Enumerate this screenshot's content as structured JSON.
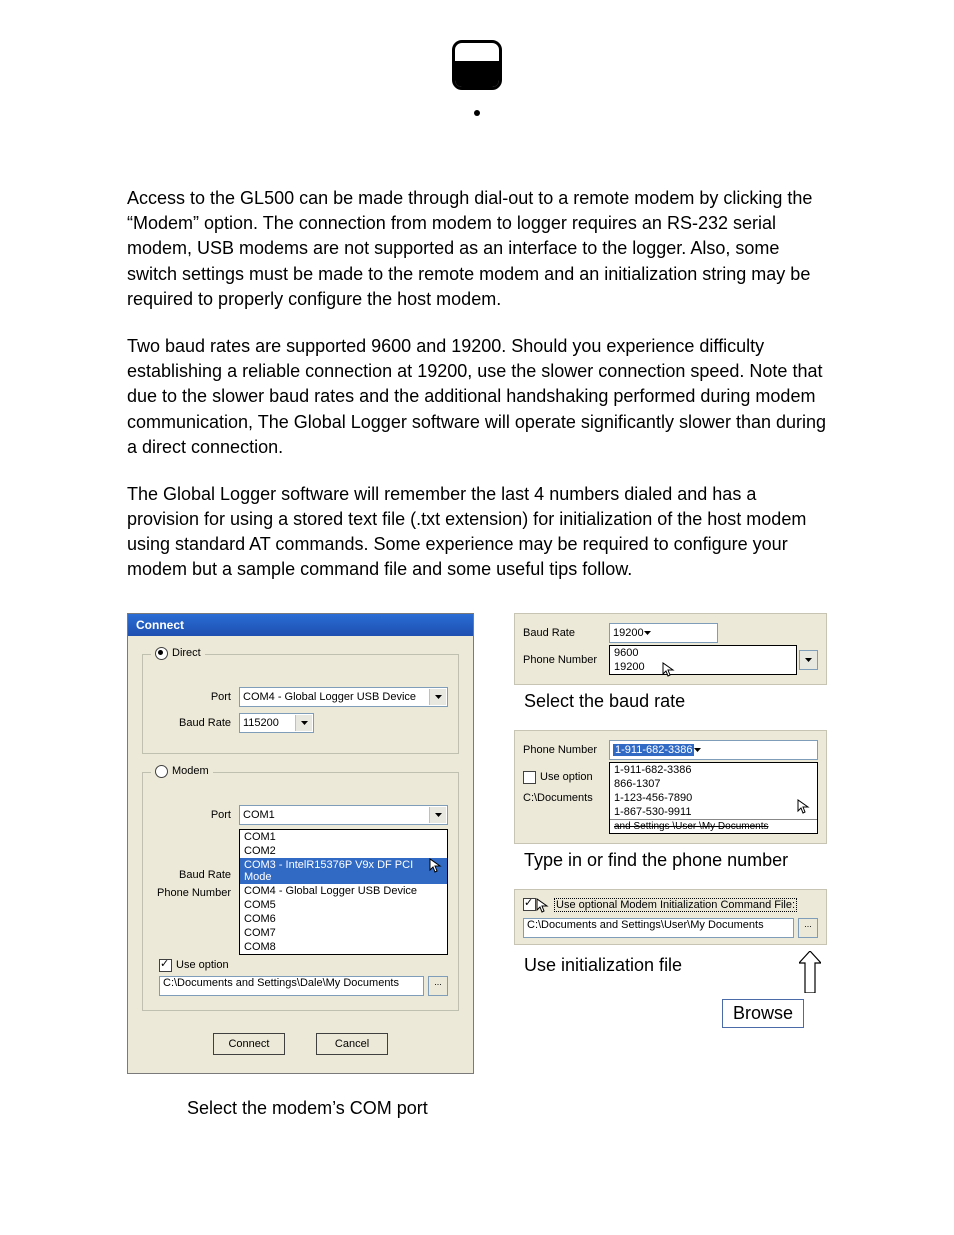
{
  "paragraphs": {
    "p1": "Access to the GL500 can be made through dial-out to a remote modem by clicking the “Modem” option.  The connection from modem to logger requires an RS-232 serial modem, USB modems are not supported as an interface to the logger.  Also, some switch settings must be made to the remote modem and an initialization string may be required to properly configure the host modem.",
    "p2": "Two baud rates are supported 9600 and 19200.  Should you experience difficulty establishing a reliable connection at 19200, use the slower connection speed.  Note that due to the slower baud rates and the additional handshaking performed during modem communication, The Global Logger software will operate significantly slower than during a direct connection.",
    "p3": "The Global Logger software will remember the last 4 numbers dialed and has a provision for using a stored text file (.txt extension) for initialization of the host modem using standard AT commands.  Some experience may be required to configure your modem but a sample command file and some useful tips follow."
  },
  "dialog": {
    "title": "Connect",
    "direct": {
      "label": "Direct",
      "port_label": "Port",
      "port_value": "COM4 - Global Logger USB Device",
      "baud_label": "Baud Rate",
      "baud_value": "115200"
    },
    "modem": {
      "label": "Modem",
      "port_label": "Port",
      "port_value": "COM1",
      "baud_label": "Baud Rate",
      "phone_label": "Phone Number",
      "use_option_label": "Use option",
      "path_value": "C:\\Documents and Settings\\Dale\\My Documents",
      "dropdown": {
        "o1": "COM1",
        "o2": "COM2",
        "o3": "COM3 - IntelR15376P V9x DF PCI Mode",
        "o4": "COM4 - Global Logger USB Device",
        "o5": "COM5",
        "o6": "COM6",
        "o7": "COM7",
        "o8": "COM8"
      }
    },
    "connect_btn": "Connect",
    "cancel_btn": "Cancel",
    "browse_btn": "...",
    "caption": "Select the modem’s COM port"
  },
  "right": {
    "baud": {
      "baud_label": "Baud Rate",
      "baud_value": "19200",
      "phone_label": "Phone Number",
      "opt1": "9600",
      "opt2": "19200",
      "caption": "Select the baud rate"
    },
    "phone": {
      "phone_label": "Phone Number",
      "phone_value": "1-911-682-3386",
      "use_option_label": "Use option",
      "path_prefix": "C:\\Documents",
      "path_suffix": " and Settings \\User \\My Documents",
      "opt1": "1-911-682-3386",
      "opt2": "866-1307",
      "opt3": "1-123-456-7890",
      "opt4": "1-867-530-9911",
      "caption": "Type in or find the phone number"
    },
    "init": {
      "check_label": "Use optional Modem Initialization Command File:",
      "path_value": "C:\\Documents and Settings\\User\\My Documents",
      "caption": "Use initialization file",
      "browse_label": "Browse",
      "browse_btn": "..."
    }
  }
}
